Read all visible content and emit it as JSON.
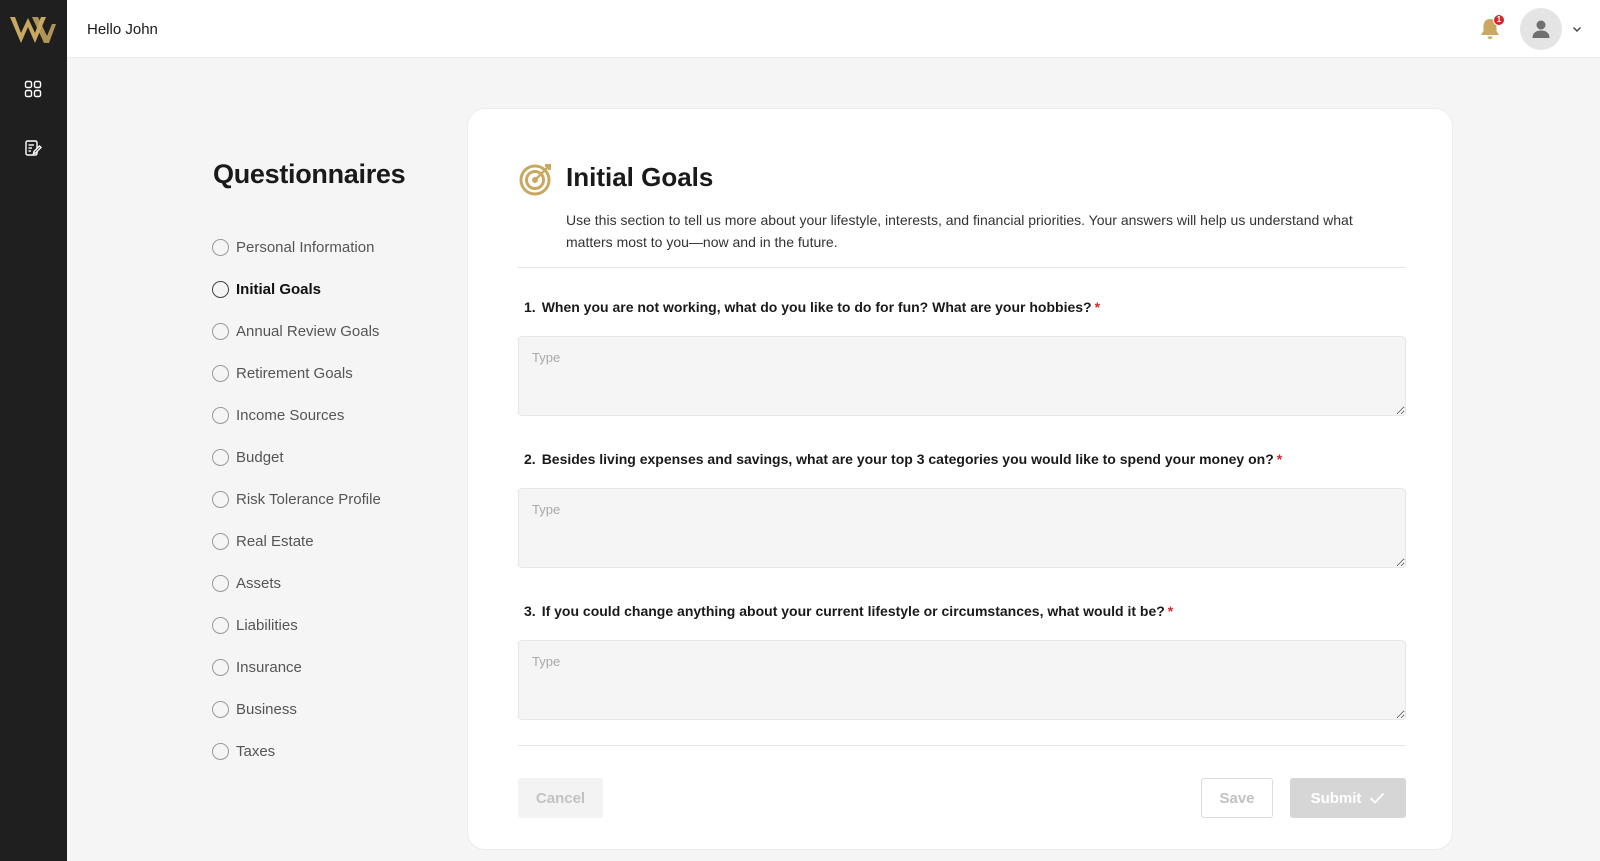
{
  "sidebar": {
    "logo_text": "W",
    "icons": [
      "dashboard-grid-icon",
      "questionnaire-edit-icon"
    ]
  },
  "topbar": {
    "greeting": "Hello John",
    "notification_count": "1"
  },
  "questionnaires": {
    "title": "Questionnaires",
    "items": [
      {
        "label": "Personal Information"
      },
      {
        "label": "Initial Goals"
      },
      {
        "label": "Annual Review Goals"
      },
      {
        "label": "Retirement Goals"
      },
      {
        "label": "Income Sources"
      },
      {
        "label": "Budget"
      },
      {
        "label": "Risk Tolerance Profile"
      },
      {
        "label": "Real Estate"
      },
      {
        "label": "Assets"
      },
      {
        "label": "Liabilities"
      },
      {
        "label": "Insurance"
      },
      {
        "label": "Business"
      },
      {
        "label": "Taxes"
      }
    ],
    "active_item": "Initial Goals"
  },
  "section": {
    "title": "Initial Goals",
    "description": "Use this section to tell us more about your lifestyle, interests, and financial priorities. Your answers will help us understand what matters most to you—now and in the future.",
    "questions": [
      {
        "number": "1.",
        "text": "When you are not working, what do you like to do for fun? What are your hobbies?",
        "required_mark": "*",
        "placeholder": "Type",
        "value": ""
      },
      {
        "number": "2.",
        "text": "Besides living expenses and savings, what are your top 3 categories you would like to spend your money on?",
        "required_mark": "*",
        "placeholder": "Type",
        "value": ""
      },
      {
        "number": "3.",
        "text": "If you could change anything about your current lifestyle or circumstances, what would it be?",
        "required_mark": "*",
        "placeholder": "Type",
        "value": ""
      }
    ]
  },
  "actions": {
    "cancel_label": "Cancel",
    "save_label": "Save",
    "submit_label": "Submit"
  },
  "colors": {
    "brand_gold": "#c9a961",
    "sidebar_bg": "#1f1f1f",
    "required_red": "#d6262b",
    "page_bg": "#f5f5f5"
  }
}
